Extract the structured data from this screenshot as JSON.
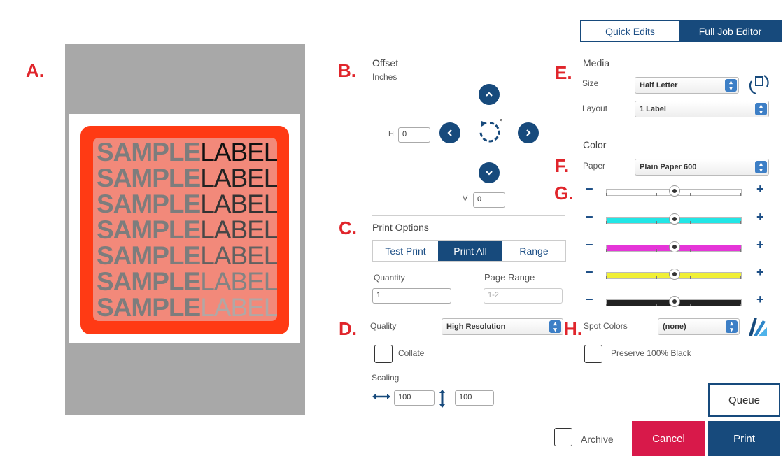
{
  "header": {
    "tabs": [
      {
        "label": "Quick Edits",
        "active": false
      },
      {
        "label": "Full Job Editor",
        "active": true
      }
    ]
  },
  "markers": {
    "a": "A.",
    "b": "B.",
    "c": "C.",
    "d": "D.",
    "e": "E.",
    "f": "F.",
    "g": "G.",
    "h": "H."
  },
  "preview": {
    "rows": [
      {
        "left": "SAMPLE",
        "right": "LABEL",
        "right_color": "#111111"
      },
      {
        "left": "SAMPLE",
        "right": "LABEL",
        "right_color": "#222222"
      },
      {
        "left": "SAMPLE",
        "right": "LABEL",
        "right_color": "#333333"
      },
      {
        "left": "SAMPLE",
        "right": "LABEL",
        "right_color": "#474747"
      },
      {
        "left": "SAMPLE",
        "right": "LABEL",
        "right_color": "#616161"
      },
      {
        "left": "SAMPLE",
        "right": "LABEL",
        "right_color": "#838383"
      },
      {
        "left": "SAMPLE",
        "right": "LABEL",
        "right_color": "#b0a8a6"
      }
    ],
    "colors": {
      "frame": "#ff3a14",
      "inner": "#f2897a",
      "page": "#a8a8a8"
    }
  },
  "offset": {
    "title": "Offset",
    "units": "Inches",
    "h_label": "H",
    "h_value": "0",
    "v_label": "V",
    "v_value": "0",
    "rotate_degree_symbol": "°"
  },
  "print_options": {
    "title": "Print Options",
    "modes": [
      {
        "label": "Test Print",
        "active": false
      },
      {
        "label": "Print All",
        "active": true
      },
      {
        "label": "Range",
        "active": false
      }
    ],
    "quantity_label": "Quantity",
    "quantity_value": "1",
    "page_range_label": "Page Range",
    "page_range_value": "1-2",
    "quality_label": "Quality",
    "quality_value": "High Resolution",
    "collate_label": "Collate",
    "scaling_label": "Scaling",
    "scale_h": "100",
    "scale_v": "100"
  },
  "media": {
    "title": "Media",
    "size_label": "Size",
    "size_value": "Half Letter",
    "layout_label": "Layout",
    "layout_value": "1 Label"
  },
  "color": {
    "title": "Color",
    "paper_label": "Paper",
    "paper_value": "Plain Paper 600",
    "minus": "−",
    "plus": "+",
    "sliders": [
      {
        "name": "overall",
        "fill": "#ffffff",
        "value": 0.5
      },
      {
        "name": "cyan",
        "fill": "#22e6e6",
        "value": 0.5
      },
      {
        "name": "magenta",
        "fill": "#e535d8",
        "value": 0.5
      },
      {
        "name": "yellow",
        "fill": "#f0ef36",
        "value": 0.5
      },
      {
        "name": "black",
        "fill": "#222222",
        "value": 0.5
      }
    ],
    "spot_colors_label": "Spot Colors",
    "spot_colors_value": "(none)",
    "preserve_black_label": "Preserve 100% Black"
  },
  "footer": {
    "queue_label": "Queue",
    "archive_label": "Archive",
    "cancel_label": "Cancel",
    "print_label": "Print",
    "colors": {
      "cancel": "#d8194a",
      "print": "#174a7c"
    }
  }
}
